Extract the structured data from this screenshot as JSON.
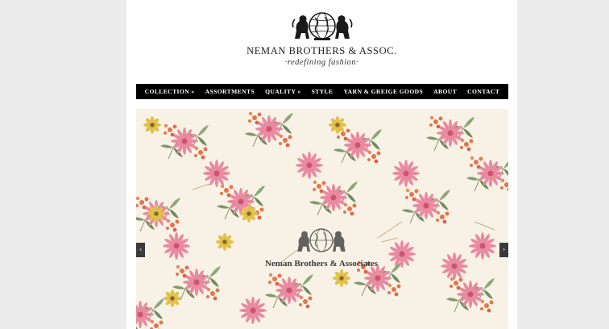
{
  "header": {
    "brand_name": "NEMAN BROTHERS & ASSOC.",
    "tagline": "·redefining fashion·"
  },
  "nav": {
    "items": [
      {
        "label": "COLLECTION »"
      },
      {
        "label": "ASSORTMENTS"
      },
      {
        "label": "QUALITY »"
      },
      {
        "label": "STYLE"
      },
      {
        "label": "YARN & GREIGE GOODS"
      },
      {
        "label": "ABOUT"
      },
      {
        "label": "CONTACT"
      }
    ]
  },
  "slider": {
    "watermark_text": "Neman Brothers & Associates",
    "prev_label": "‹",
    "next_label": "›"
  },
  "colors": {
    "page_bg": "#ececec",
    "nav_bg": "#000000",
    "fabric_bg": "#f8f2e6",
    "flower_pink": "#e98aa0",
    "flower_coral": "#e2754f",
    "flower_yellow": "#e2c14a",
    "leaf_green": "#7f9a6e"
  }
}
